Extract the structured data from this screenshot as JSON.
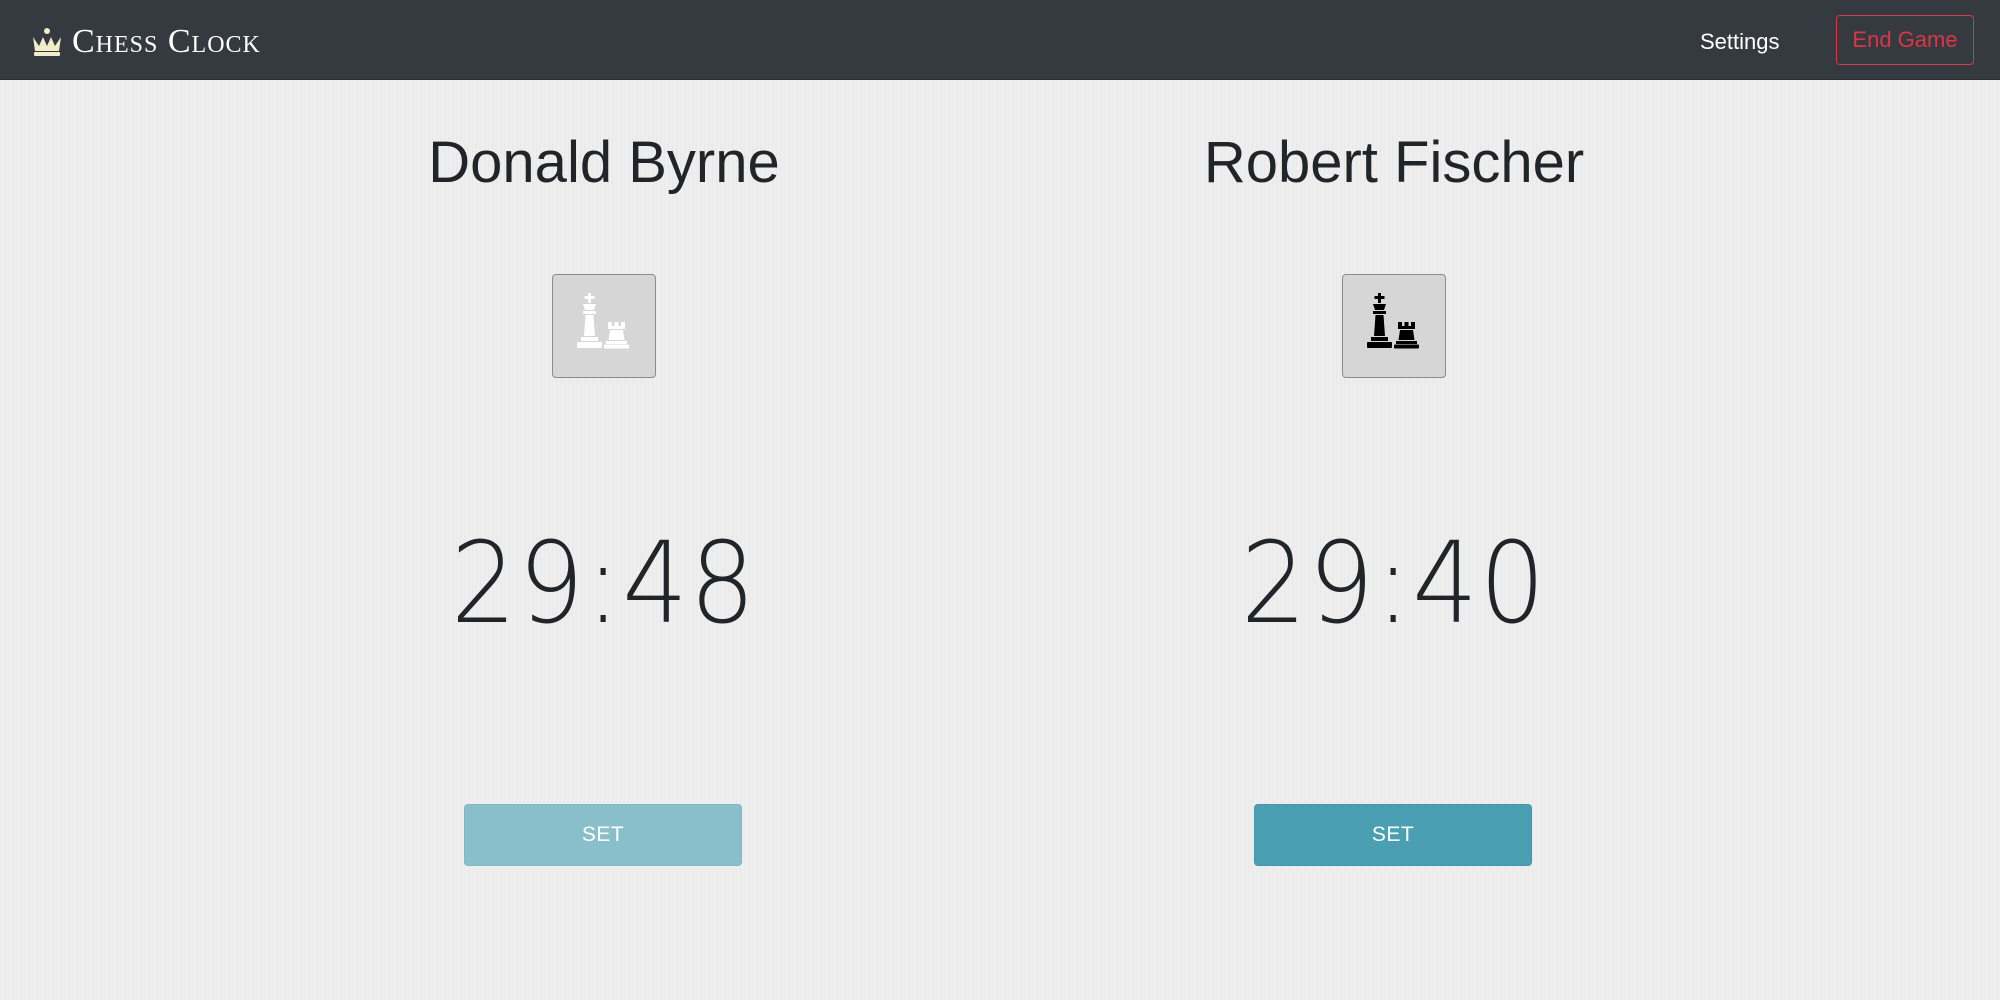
{
  "navbar": {
    "brand_icon": "crown-icon",
    "brand_text": "Chess Clock",
    "settings_label": "Settings",
    "end_game_label": "End Game",
    "end_game_color": "#dc3545",
    "background_color": "#343a40"
  },
  "players": [
    {
      "name": "Donald Byrne",
      "side": "white",
      "side_icon": "white-king-rook-icon",
      "time": "29:48",
      "set_label": "SET",
      "set_disabled": true
    },
    {
      "name": "Robert Fischer",
      "side": "black",
      "side_icon": "black-king-rook-icon",
      "time": "29:40",
      "set_label": "SET",
      "set_disabled": false
    }
  ],
  "colors": {
    "set_button": "#4aa0b2",
    "set_button_disabled": "#88bfcb",
    "page_background": "#eeeeee"
  }
}
